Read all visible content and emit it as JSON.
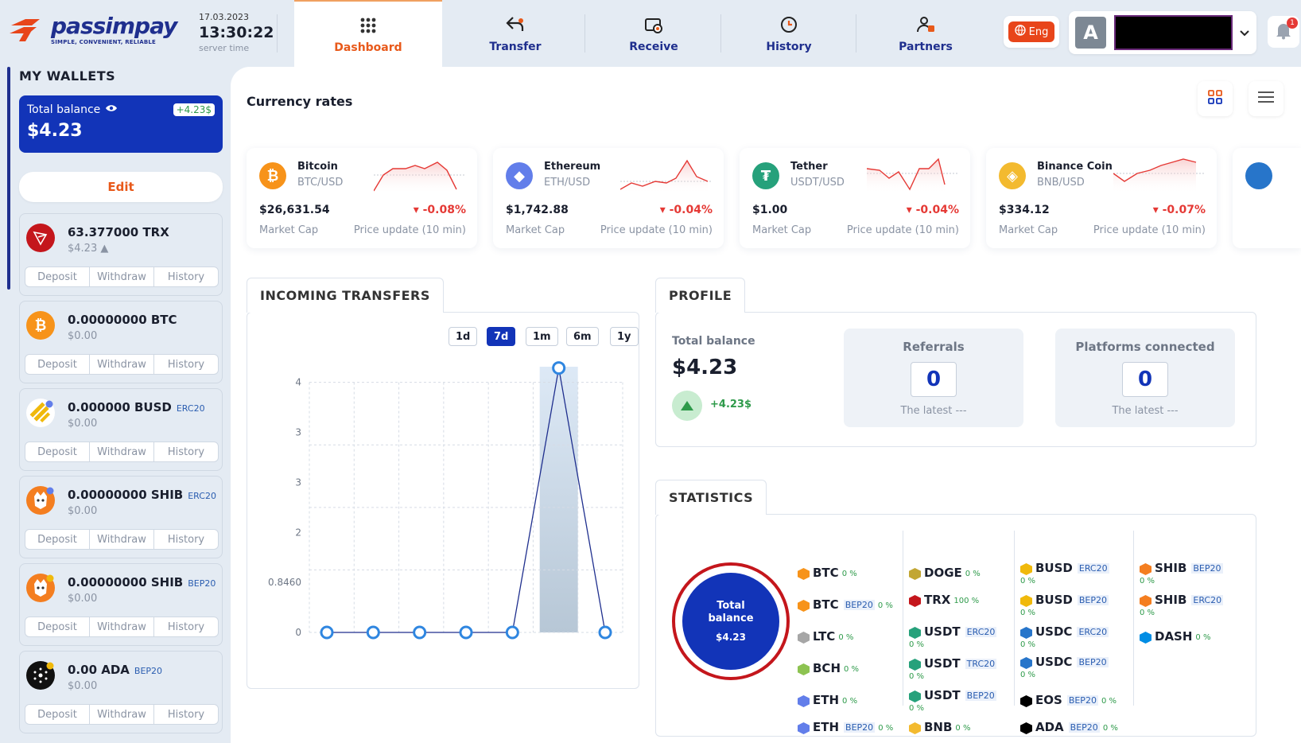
{
  "brand": {
    "name": "passimpay",
    "tagline": "SIMPLE, CONVENIENT, RELIABLE"
  },
  "clock": {
    "date": "17.03.2023",
    "time": "13:30:22",
    "label": "server time"
  },
  "nav": {
    "dashboard": "Dashboard",
    "transfer": "Transfer",
    "receive": "Receive",
    "history": "History",
    "partners": "Partners"
  },
  "lang": "Eng",
  "user": {
    "initial": "A",
    "notifications": "1"
  },
  "sidebar": {
    "title": "MY WALLETS",
    "total_label": "Total balance",
    "total_amount": "$4.23",
    "total_change": "+4.23$",
    "edit": "Edit",
    "actions": {
      "deposit": "Deposit",
      "withdraw": "Withdraw",
      "history": "History"
    },
    "wallets": [
      {
        "amount": "63.377000 TRX",
        "network": "",
        "fiat": "$4.23 ▲"
      },
      {
        "amount": "0.00000000 BTC",
        "network": "",
        "fiat": "$0.00"
      },
      {
        "amount": "0.000000 BUSD",
        "network": "ERC20",
        "fiat": "$0.00"
      },
      {
        "amount": "0.00000000 SHIB",
        "network": "ERC20",
        "fiat": "$0.00"
      },
      {
        "amount": "0.00000000 SHIB",
        "network": "BEP20",
        "fiat": "$0.00"
      },
      {
        "amount": "0.00 ADA",
        "network": "BEP20",
        "fiat": "$0.00"
      }
    ]
  },
  "rates": {
    "title": "Currency rates",
    "mcap_label": "Market Cap",
    "update_label": "Price update (10 min)",
    "items": [
      {
        "name": "Bitcoin",
        "pair": "BTC/USD",
        "price": "$26,631.54",
        "change": "▾ -0.08%",
        "color": "#f7931a",
        "symbol": "₿"
      },
      {
        "name": "Ethereum",
        "pair": "ETH/USD",
        "price": "$1,742.88",
        "change": "▾ -0.04%",
        "color": "#627eea",
        "symbol": "◆"
      },
      {
        "name": "Tether",
        "pair": "USDT/USD",
        "price": "$1.00",
        "change": "▾ -0.04%",
        "color": "#26a17b",
        "symbol": "₮"
      },
      {
        "name": "Binance Coin",
        "pair": "BNB/USD",
        "price": "$334.12",
        "change": "▾ -0.07%",
        "color": "#f3ba2f",
        "symbol": "◈"
      }
    ]
  },
  "incoming": {
    "title": "INCOMING TRANSFERS",
    "periods": [
      "1d",
      "7d",
      "1m",
      "6m",
      "1y"
    ],
    "active_period": "7d"
  },
  "chart_data": {
    "type": "line",
    "x": [
      "1",
      "2",
      "3",
      "4",
      "5",
      "6",
      "7"
    ],
    "series": [
      {
        "values": [
          0,
          0,
          0,
          0,
          0,
          4.23,
          0
        ]
      }
    ],
    "yticks": [
      "0",
      "0.8460",
      "2",
      "3",
      "3",
      "4"
    ],
    "ylim": [
      0,
      5
    ],
    "grid": true,
    "highlight_index": 5
  },
  "profile": {
    "title": "PROFILE",
    "total_label": "Total balance",
    "total_amount": "$4.23",
    "total_change": "+4.23$",
    "referrals_label": "Referrals",
    "referrals_count": "0",
    "platforms_label": "Platforms connected",
    "platforms_count": "0",
    "latest": "The latest ---"
  },
  "statistics": {
    "title": "STATISTICS",
    "donut_label": "Total balance",
    "donut_value": "$4.23",
    "items": [
      {
        "sym": "BTC",
        "net": "",
        "pct": "0 %",
        "color": "#f7931a"
      },
      {
        "sym": "BTC",
        "net": "BEP20",
        "pct": "0 %",
        "color": "#f7931a"
      },
      {
        "sym": "LTC",
        "net": "",
        "pct": "0 %",
        "color": "#a6a6a6"
      },
      {
        "sym": "BCH",
        "net": "",
        "pct": "0 %",
        "color": "#8dc351"
      },
      {
        "sym": "ETH",
        "net": "",
        "pct": "0 %",
        "color": "#627eea"
      },
      {
        "sym": "ETH",
        "net": "BEP20",
        "pct": "0 %",
        "color": "#627eea"
      },
      {
        "sym": "DOGE",
        "net": "",
        "pct": "0 %",
        "color": "#c2a633"
      },
      {
        "sym": "TRX",
        "net": "",
        "pct": "100 %",
        "color": "#c4161c"
      },
      {
        "sym": "USDT",
        "net": "ERC20",
        "pct": "0 %",
        "color": "#26a17b"
      },
      {
        "sym": "USDT",
        "net": "TRC20",
        "pct": "0 %",
        "color": "#26a17b"
      },
      {
        "sym": "USDT",
        "net": "BEP20",
        "pct": "0 %",
        "color": "#26a17b"
      },
      {
        "sym": "BNB",
        "net": "",
        "pct": "0 %",
        "color": "#f3ba2f"
      },
      {
        "sym": "BUSD",
        "net": "ERC20",
        "pct": "0 %",
        "color": "#f0b90b"
      },
      {
        "sym": "BUSD",
        "net": "BEP20",
        "pct": "0 %",
        "color": "#f0b90b"
      },
      {
        "sym": "USDC",
        "net": "ERC20",
        "pct": "0 %",
        "color": "#2775ca"
      },
      {
        "sym": "USDC",
        "net": "BEP20",
        "pct": "0 %",
        "color": "#2775ca"
      },
      {
        "sym": "EOS",
        "net": "BEP20",
        "pct": "0 %",
        "color": "#000000"
      },
      {
        "sym": "ADA",
        "net": "BEP20",
        "pct": "0 %",
        "color": "#000000"
      },
      {
        "sym": "SHIB",
        "net": "BEP20",
        "pct": "0 %",
        "color": "#f47e20"
      },
      {
        "sym": "SHIB",
        "net": "ERC20",
        "pct": "0 %",
        "color": "#f47e20"
      },
      {
        "sym": "DASH",
        "net": "",
        "pct": "0 %",
        "color": "#008de4"
      }
    ]
  }
}
